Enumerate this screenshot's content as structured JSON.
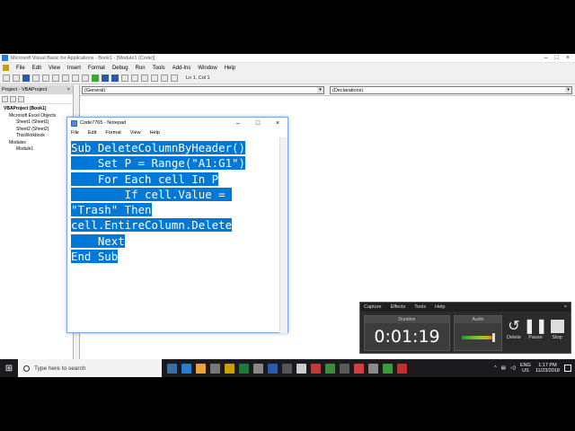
{
  "vba": {
    "title": "Microsoft Visual Basic for Applications - Book1 - [Module1 (Code)]",
    "menu": [
      "File",
      "Edit",
      "View",
      "Insert",
      "Format",
      "Debug",
      "Run",
      "Tools",
      "Add-Ins",
      "Window",
      "Help"
    ],
    "cursor_pos": "Ln 1, Col 1",
    "project_header": "Project - VBAProject",
    "tree": [
      {
        "label": "VBAProject (Book1)",
        "level": 1
      },
      {
        "label": "Microsoft Excel Objects",
        "level": 2
      },
      {
        "label": "Sheet1 (Sheet1)",
        "level": 3
      },
      {
        "label": "Sheet2 (Sheet2)",
        "level": 3
      },
      {
        "label": "ThisWorkbook",
        "level": 3
      },
      {
        "label": "Modules",
        "level": 2
      },
      {
        "label": "Module1",
        "level": 3
      }
    ],
    "combo_object": "(General)",
    "combo_proc": "(Declarations)"
  },
  "notepad": {
    "title": "Code7765 - Notepad",
    "menu": [
      "File",
      "Edit",
      "Format",
      "View",
      "Help"
    ],
    "lines": [
      "Sub DeleteColumnByHeader()",
      "    Set P = Range(\"A1:G1\")",
      "    For Each cell In P",
      "        If cell.Value = ",
      "\"Trash\" Then",
      "cell.EntireColumn.Delete",
      "    Next",
      "End Sub"
    ]
  },
  "recorder": {
    "menu": [
      "Capture",
      "Effects",
      "Tools",
      "Help"
    ],
    "duration_label": "Duration",
    "duration": "0:01:19",
    "audio_label": "Audio",
    "audio_level": 0.85,
    "delete_label": "Delete",
    "pause_label": "Pause",
    "stop_label": "Stop"
  },
  "taskbar": {
    "search_placeholder": "Type here to search",
    "lang_top": "ENG",
    "lang_bottom": "US",
    "time": "1:17 PM",
    "date": "11/23/2018",
    "apps": [
      "#3a6ea5",
      "#2b7cd3",
      "#e8a33c",
      "#777777",
      "#c8a000",
      "#1f7a3a",
      "#888888",
      "#2a5aa8",
      "#555555",
      "#cccccc",
      "#c33a3a",
      "#3c8c3c",
      "#5a5a5a",
      "#d04040",
      "#8a8a8a",
      "#3c9a3c",
      "#c03030"
    ]
  },
  "colors": {
    "selection": "#0078d7",
    "taskbar": "#1b1b1f",
    "recorder_bg": "#2b2b2b"
  }
}
